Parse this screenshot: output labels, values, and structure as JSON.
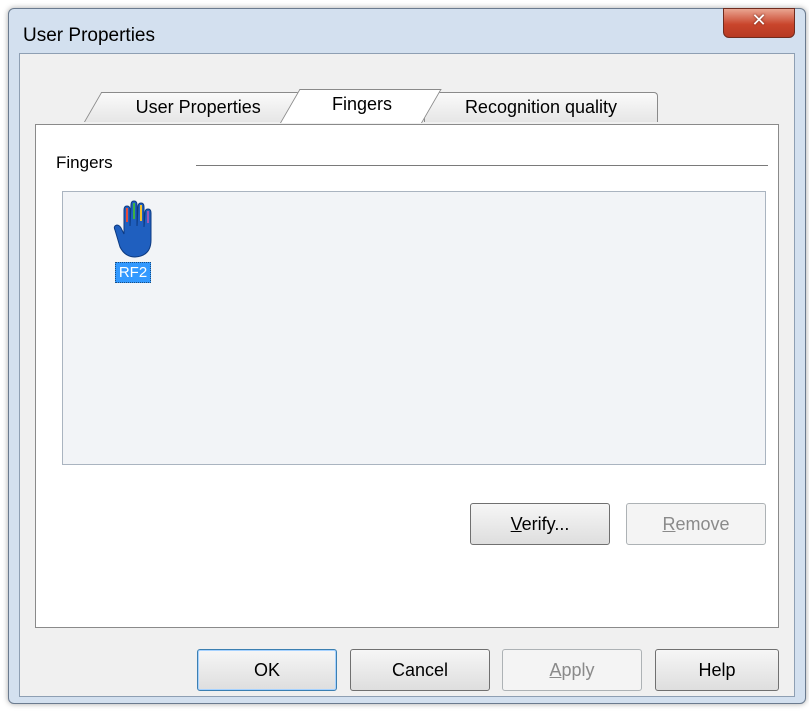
{
  "window": {
    "title": "User Properties"
  },
  "tabs": [
    {
      "label": "User Properties",
      "active": false
    },
    {
      "label": "Fingers",
      "active": true
    },
    {
      "label": "Recognition quality",
      "active": false
    }
  ],
  "fingers_group": {
    "label": "Fingers",
    "items": [
      {
        "icon": "hand-icon",
        "label": "RF2",
        "selected": true
      }
    ],
    "verify_button": {
      "first": "V",
      "rest": "erify..."
    },
    "remove_button": {
      "first": "R",
      "rest": "emove",
      "disabled": true
    }
  },
  "buttons": {
    "ok": "OK",
    "cancel": "Cancel",
    "apply": {
      "first": "A",
      "rest": "pply",
      "disabled": true
    },
    "help": "Help"
  },
  "colors": {
    "selection": "#3399ff",
    "hand": "#1f5fbf"
  }
}
